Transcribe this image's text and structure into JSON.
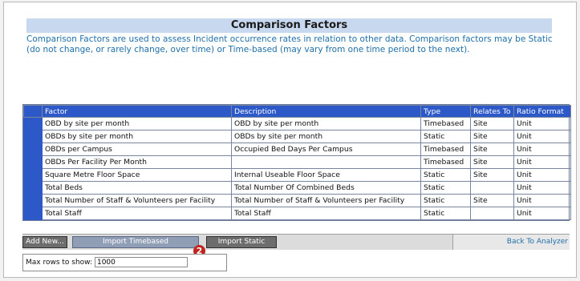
{
  "header": {
    "title": "Comparison Factors",
    "intro": "Comparison Factors are used to assess Incident occurrence rates in relation to other data. Comparison factors may be Static (do not change, or rarely change, over time) or Time-based (may vary from one time period to the next)."
  },
  "table": {
    "columns": [
      "Factor",
      "Description",
      "Type",
      "Relates To",
      "Ratio Format"
    ],
    "rows": [
      [
        "OBD by site per month",
        "OBD by site per month",
        "Timebased",
        "Site",
        "Unit"
      ],
      [
        "OBDs by site per month",
        "OBDs by site per month",
        "Static",
        "Site",
        "Unit"
      ],
      [
        "OBDs per Campus",
        "Occupied Bed Days Per Campus",
        "Timebased",
        "Site",
        "Unit"
      ],
      [
        "OBDs Per Facility Per Month",
        "",
        "Timebased",
        "Site",
        "Unit"
      ],
      [
        "Square Metre Floor Space",
        "Internal Useable Floor Space",
        "Static",
        "Site",
        "Unit"
      ],
      [
        "Total Beds",
        "Total Number Of Combined Beds",
        "Static",
        "",
        "Unit"
      ],
      [
        "Total Number of Staff & Volunteers per Facility",
        "Total Number of Staff & Volunteers per Facility",
        "Static",
        "Site",
        "Unit"
      ],
      [
        "Total Staff",
        "Total Staff",
        "Static",
        "",
        "Unit"
      ]
    ]
  },
  "buttons": {
    "add_new": "Add New...",
    "import_timebased": "Import Timebased",
    "import_static": "Import Static",
    "back": "Back To Analyzer"
  },
  "badge": "2",
  "max_rows": {
    "label": "Max rows to show:",
    "value": "1000"
  },
  "colors": {
    "header_blue": "#2c58c8",
    "title_bar": "#c7d8ef",
    "link_blue": "#1f6fa8",
    "badge_red": "#c0261e"
  }
}
